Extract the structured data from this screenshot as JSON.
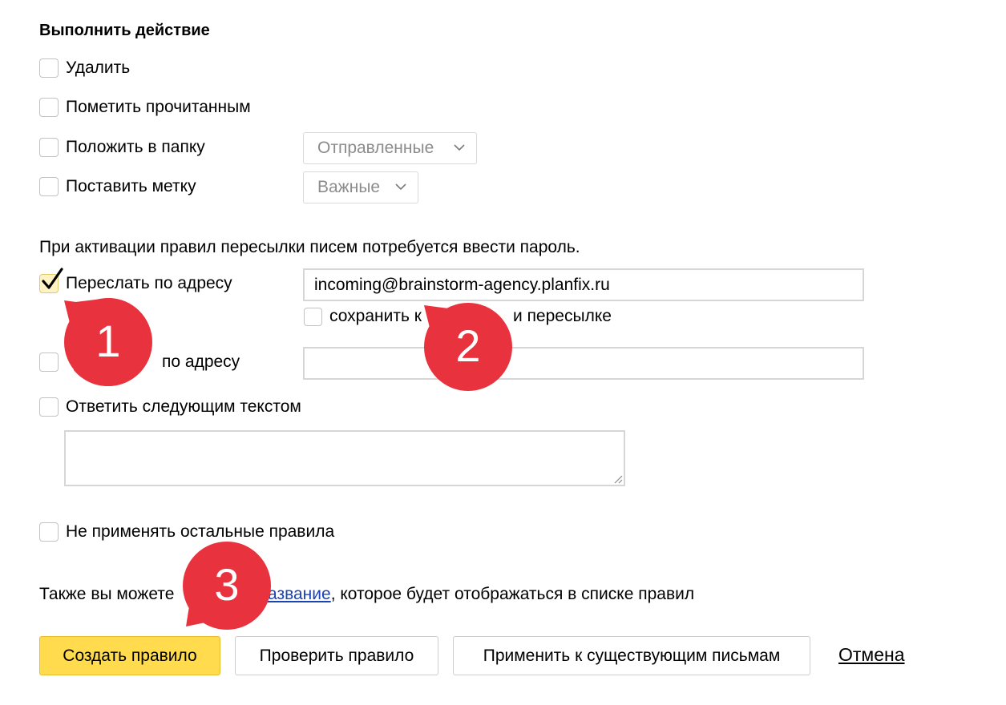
{
  "section": {
    "title": "Выполнить действие"
  },
  "actions": {
    "delete_label": "Удалить",
    "mark_read_label": "Пометить прочитанным",
    "move_folder_label": "Положить в папку",
    "folder_select_value": "Отправленные",
    "set_label_label": "Поставить метку",
    "label_select_value": "Важные"
  },
  "forwarding": {
    "notice": "При активации правил пересылки писем потребуется ввести пароль.",
    "forward_label": "Переслать по адресу",
    "forward_checked": true,
    "forward_email": "incoming@brainstorm-agency.planfix.ru",
    "keep_copy_label_left": "сохранить к",
    "keep_copy_label_right": "и пересылке",
    "notify_label": "по адресу"
  },
  "reply": {
    "label": "Ответить следующим текстом"
  },
  "stop": {
    "label": "Не применять остальные правила"
  },
  "footer": {
    "text_before": "Также вы можете",
    "link_text": "азвание",
    "text_after": ", которое будет отображаться в списке правил"
  },
  "buttons": {
    "create": "Создать правило",
    "check": "Проверить правило",
    "apply": "Применить к существующим письмам",
    "cancel": "Отмена"
  },
  "markers": [
    "1",
    "2",
    "3"
  ],
  "colors": {
    "accent_yellow": "#ffdb4d",
    "marker_red": "#e8333f",
    "link_blue": "#1a43b3"
  }
}
